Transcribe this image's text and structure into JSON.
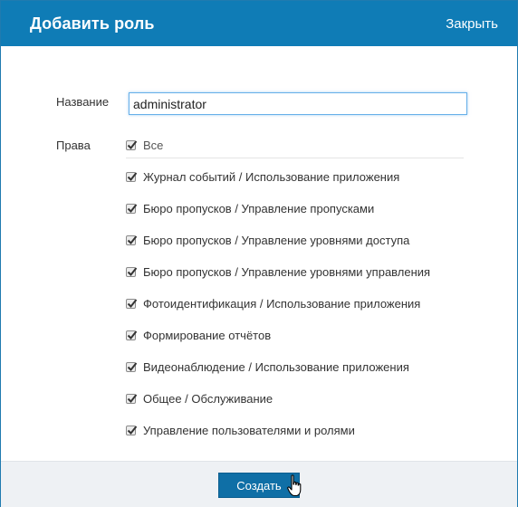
{
  "dialog": {
    "title": "Добавить роль",
    "close_label": "Закрыть"
  },
  "form": {
    "name_label": "Название",
    "name_value": "administrator",
    "rights_label": "Права",
    "all_label": "Все",
    "permissions": [
      "Журнал событий / Использование приложения",
      "Бюро пропусков / Управление пропусками",
      "Бюро пропусков / Управление уровнями доступа",
      "Бюро пропусков / Управление уровнями управления",
      "Фотоидентификация / Использование приложения",
      "Формирование отчётов",
      "Видеонаблюдение / Использование приложения",
      "Общее / Обслуживание",
      "Управление пользователями и ролями"
    ],
    "all_checked": true,
    "permissions_checked": [
      true,
      true,
      true,
      true,
      true,
      true,
      true,
      true,
      true
    ]
  },
  "footer": {
    "create_label": "Создать"
  },
  "colors": {
    "header_bg": "#0f7cb6",
    "button_bg": "#0f6fa6",
    "footer_bg": "#eef1f4"
  }
}
